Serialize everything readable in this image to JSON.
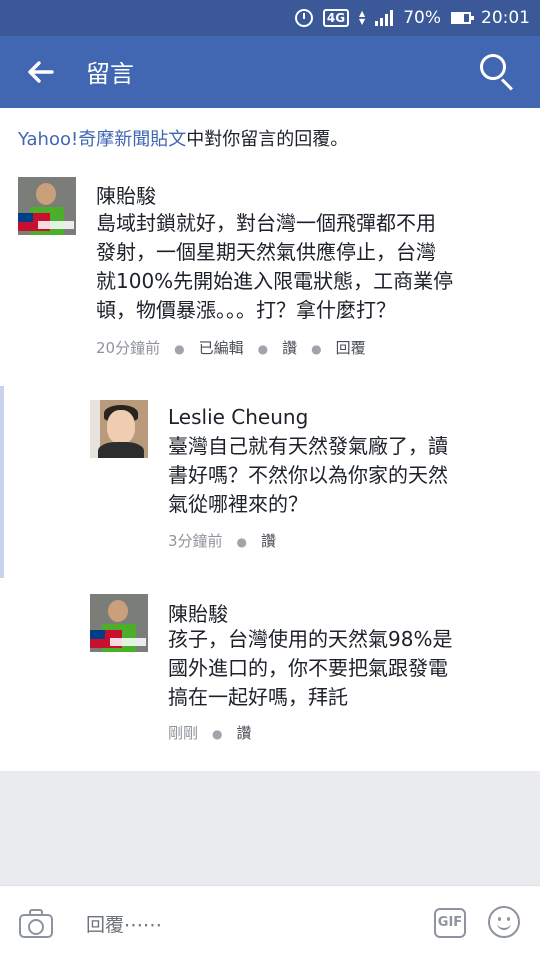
{
  "status_bar": {
    "network": "4G",
    "battery": "70%",
    "time": "20:01"
  },
  "app_bar": {
    "title": "留言"
  },
  "notice": {
    "link_text": "Yahoo!奇摩新聞貼文",
    "rest_text": "中對你留言的回覆。"
  },
  "comments": [
    {
      "author": "陳貽駿",
      "lines": [
        "島域封鎖就好，對台灣一個飛彈都不用",
        "發射，一個星期天然氣供應停止，台灣",
        "就100%先開始進入限電狀態，工商業停",
        "頓，物價暴漲。。。打？拿什麼打？"
      ],
      "time": "20分鐘前",
      "edited": "已編輯",
      "like": "讚",
      "reply": "回覆"
    },
    {
      "author": "Leslie Cheung",
      "lines": [
        "臺灣自己就有天然發氣廠了，讀",
        "書好嗎？不然你以為你家的天然",
        "氣從哪裡來的？"
      ],
      "time": "3分鐘前",
      "like": "讚"
    },
    {
      "author": "陳貽駿",
      "lines": [
        "孩子，台灣使用的天然氣98%是",
        "國外進口的，你不要把氣跟發電",
        "搞在一起好嗎，拜託"
      ],
      "time": "剛剛",
      "like": "讚"
    }
  ],
  "composer": {
    "placeholder": "回覆⋯⋯",
    "gif_label": "GIF"
  },
  "icons": {
    "back": "arrow-left-icon",
    "search": "search-icon",
    "camera": "camera-icon",
    "emoji": "smile-icon"
  }
}
